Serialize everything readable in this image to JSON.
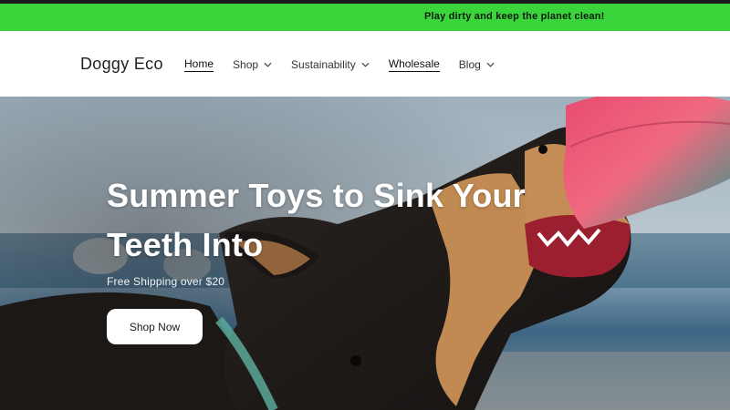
{
  "announcement": {
    "text": "Play dirty and keep the planet clean!"
  },
  "header": {
    "logo": "Doggy Eco",
    "nav": [
      {
        "label": "Home",
        "dropdown": false,
        "active": true
      },
      {
        "label": "Shop",
        "dropdown": true,
        "active": false
      },
      {
        "label": "Sustainability",
        "dropdown": true,
        "active": false
      },
      {
        "label": "Wholesale",
        "dropdown": false,
        "active": true
      },
      {
        "label": "Blog",
        "dropdown": true,
        "active": false
      }
    ]
  },
  "hero": {
    "title": "Summer Toys to Sink Your Teeth Into",
    "subtitle": "Free Shipping over $20",
    "cta_label": "Shop Now",
    "image": "dog-biting-frisbee-photo"
  },
  "colors": {
    "announcement_bg": "#3ad53b",
    "header_bg": "#ffffff",
    "button_bg": "#ffffff"
  }
}
